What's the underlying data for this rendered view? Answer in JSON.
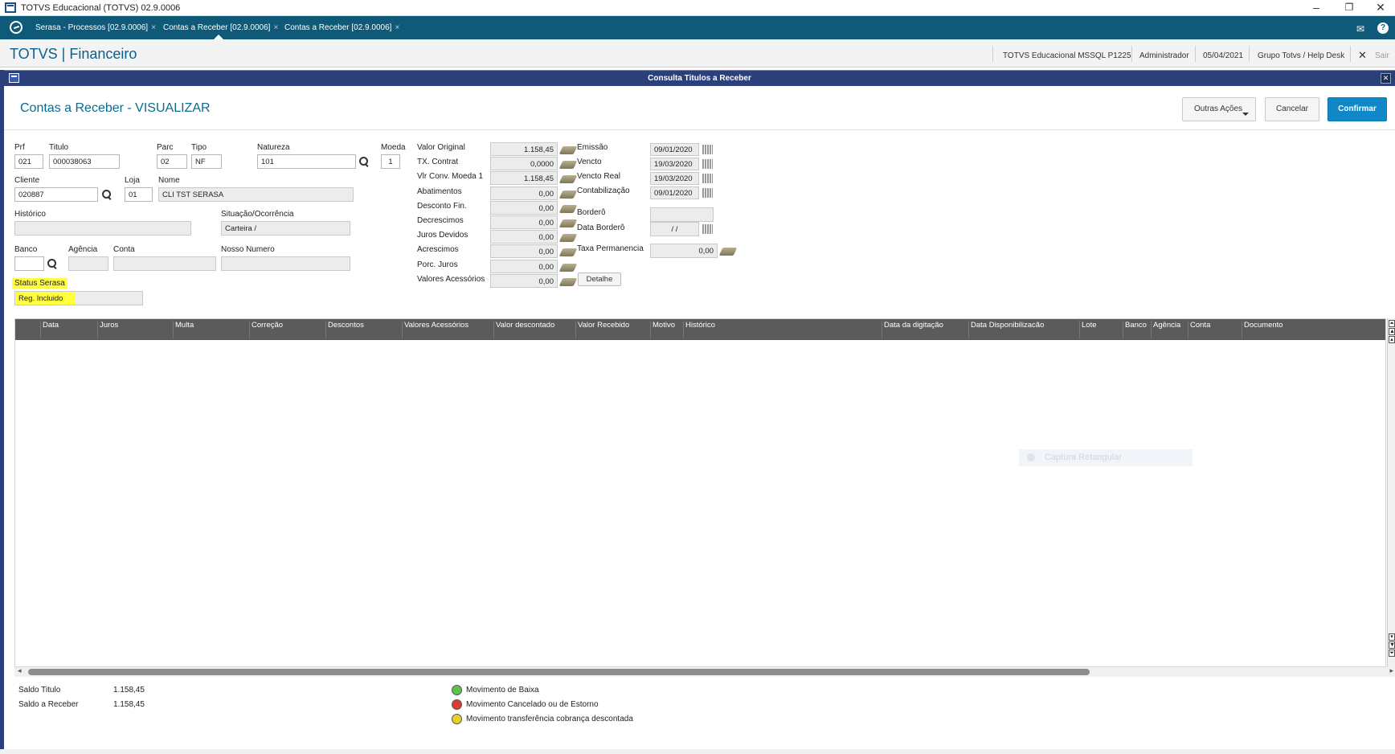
{
  "window": {
    "title": "TOTVS Educacional (TOTVS) 02.9.0006"
  },
  "tabs": [
    {
      "label": "Serasa - Processos [02.9.0006]"
    },
    {
      "label": "Contas a Receber [02.9.0006]"
    },
    {
      "label": "Contas a Receber [02.9.0006]"
    }
  ],
  "header": {
    "brand": "TOTVS | Financeiro",
    "env": "TOTVS Educacional MSSQL P1225",
    "user": "Administrador",
    "date": "05/04/2021",
    "group": "Grupo Totvs / Help Desk",
    "exit": "Sair"
  },
  "dialog": {
    "title": "Consulta Titulos a Receber"
  },
  "toolbar": {
    "page_title": "Contas a Receber - VISUALIZAR",
    "more_actions": "Outras Ações",
    "cancel": "Cancelar",
    "confirm": "Confirmar"
  },
  "form": {
    "prf": {
      "label": "Prf",
      "value": "021"
    },
    "titulo": {
      "label": "Titulo",
      "value": "000038063"
    },
    "parc": {
      "label": "Parc",
      "value": "02"
    },
    "tipo": {
      "label": "Tipo",
      "value": "NF"
    },
    "natureza": {
      "label": "Natureza",
      "value": "101"
    },
    "moeda": {
      "label": "Moeda",
      "value": "1"
    },
    "cliente": {
      "label": "Cliente",
      "value": "020887"
    },
    "loja": {
      "label": "Loja",
      "value": "01"
    },
    "nome": {
      "label": "Nome",
      "value": "CLI TST SERASA"
    },
    "historico": {
      "label": "Histórico",
      "value": ""
    },
    "situacao": {
      "label": "Situação/Ocorrência",
      "value": "Carteira /"
    },
    "banco": {
      "label": "Banco",
      "value": ""
    },
    "agencia": {
      "label": "Agência",
      "value": ""
    },
    "conta": {
      "label": "Conta",
      "value": ""
    },
    "nosso_numero": {
      "label": "Nosso Numero",
      "value": ""
    },
    "status_serasa": {
      "label": "Status Serasa",
      "value": "Reg. Incluido"
    }
  },
  "values": [
    {
      "label": "Valor Original",
      "value": "1.158,45"
    },
    {
      "label": "TX. Contrat",
      "value": "0,0000"
    },
    {
      "label": "Vlr Conv. Moeda 1",
      "value": "1.158,45"
    },
    {
      "label": "Abatimentos",
      "value": "0,00"
    },
    {
      "label": "Desconto Fin.",
      "value": "0,00"
    },
    {
      "label": "Decrescimos",
      "value": "0,00"
    },
    {
      "label": "Juros Devidos",
      "value": "0,00"
    },
    {
      "label": "Acrescimos",
      "value": "0,00"
    },
    {
      "label": "Porc. Juros",
      "value": "0,00"
    },
    {
      "label": "Valores Acessórios",
      "value": "0,00"
    }
  ],
  "detail_button": "Detalhe",
  "dates": [
    {
      "label": "Emissão",
      "value": "09/01/2020"
    },
    {
      "label": "Vencto",
      "value": "19/03/2020"
    },
    {
      "label": "Vencto Real",
      "value": "19/03/2020"
    },
    {
      "label": "Contabilização",
      "value": "09/01/2020"
    }
  ],
  "bordero": {
    "label": "Borderô",
    "value": ""
  },
  "data_bordero": {
    "label": "Data Borderô",
    "value": "/ /"
  },
  "taxa": {
    "label": "Taxa Permanencia",
    "value": "0,00"
  },
  "grid": {
    "columns": [
      "Data",
      "Juros",
      "Multa",
      "Correção",
      "Descontos",
      "Valores Acessórios",
      "Valor descontado",
      "Valor Recebido",
      "Motivo",
      "Histórico",
      "Data da digitação",
      "Data Disponibilizacão",
      "Lote",
      "Banco",
      "Agência",
      "Conta",
      "Documento"
    ]
  },
  "ghost_tooltip": "Captura Retangular",
  "summary": [
    {
      "label": "Saldo Titulo",
      "value": "1.158,45"
    },
    {
      "label": "Saldo a Receber",
      "value": "1.158,45"
    }
  ],
  "legend": [
    {
      "label": "Movimento de Baixa",
      "color": "#5cc24a"
    },
    {
      "label": "Movimento Cancelado ou de Estorno",
      "color": "#e03a2e"
    },
    {
      "label": "Movimento transferência cobrança descontada",
      "color": "#e8d020"
    }
  ]
}
